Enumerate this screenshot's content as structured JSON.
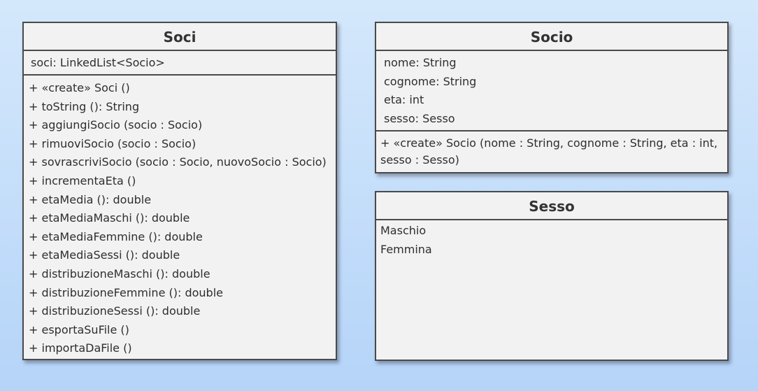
{
  "classes": {
    "soci": {
      "name": "Soci",
      "attributes": [
        "soci: LinkedList<Socio>"
      ],
      "operations": [
        "+ «create» Soci ()",
        "+ toString (): String",
        "+ aggiungiSocio (socio : Socio)",
        "+ rimuoviSocio (socio : Socio)",
        "+ sovrascriviSocio (socio : Socio, nuovoSocio : Socio)",
        "+ incrementaEta ()",
        "+ etaMedia (): double",
        "+ etaMediaMaschi (): double",
        "+ etaMediaFemmine (): double",
        "+ etaMediaSessi (): double",
        "+ distribuzioneMaschi (): double",
        "+ distribuzioneFemmine (): double",
        "+ distribuzioneSessi (): double",
        "+ esportaSuFile ()",
        "+ importaDaFile ()"
      ]
    },
    "socio": {
      "name": "Socio",
      "attributes": [
        "nome: String",
        "cognome: String",
        "eta: int",
        "sesso: Sesso"
      ],
      "operations": [
        "+ «create» Socio (nome : String, cognome : String, eta : int, sesso : Sesso)"
      ]
    },
    "sesso": {
      "name": "Sesso",
      "literals": [
        "Maschio",
        "Femmina"
      ]
    }
  }
}
